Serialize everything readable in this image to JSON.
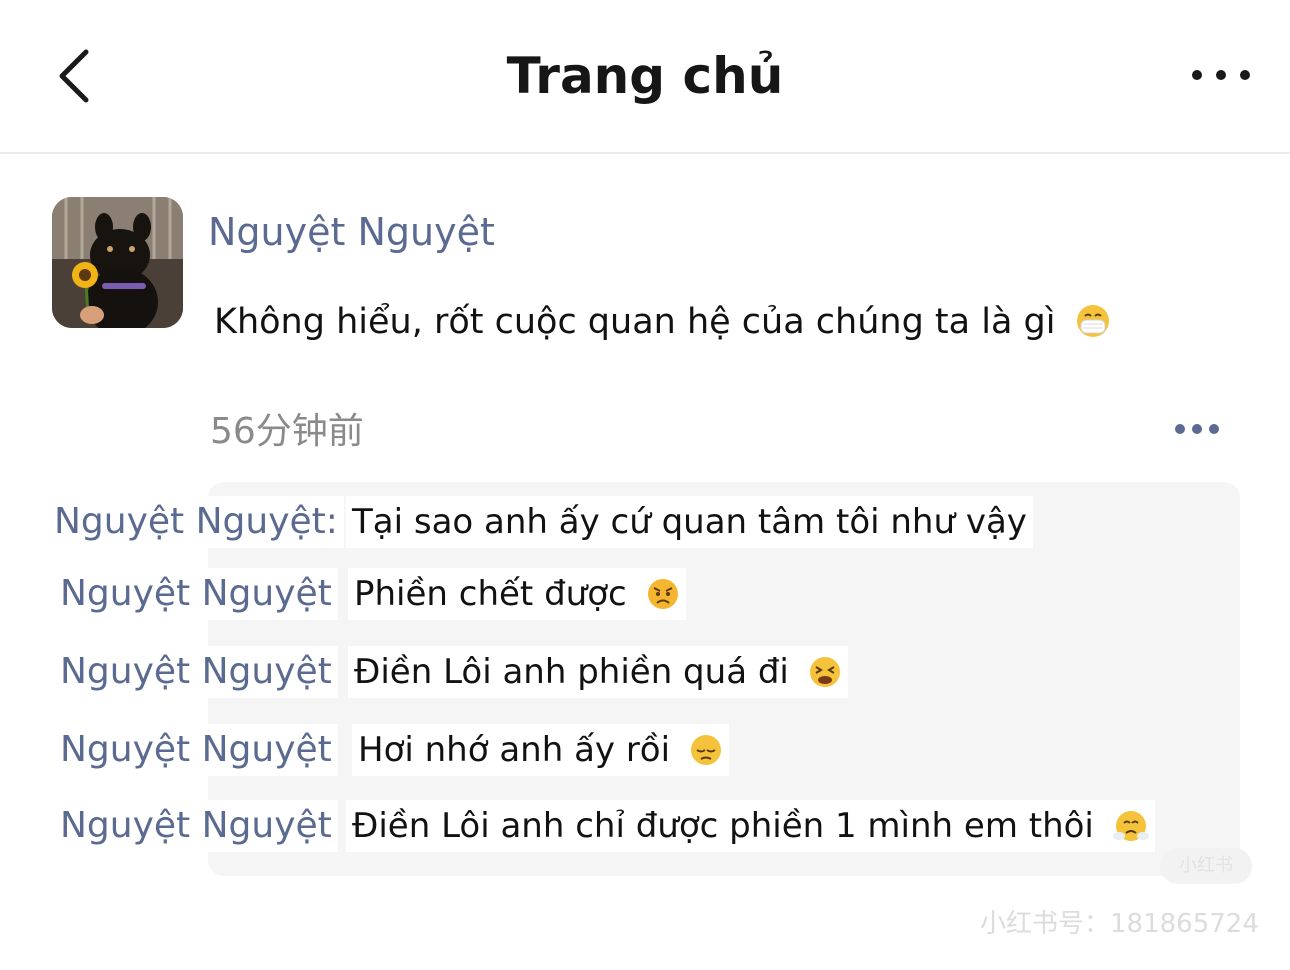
{
  "header": {
    "title": "Trang chủ",
    "back_icon": "chevron-left-icon",
    "more_icon": "more-horizontal-icon"
  },
  "post": {
    "author": "Nguyệt Nguyệt",
    "avatar_icon": "dog-with-sunflower-avatar",
    "text": "Không hiểu, rốt cuộc quan hệ của chúng ta là gì",
    "text_emoji": "face-with-medical-mask-emoji",
    "timestamp": "56分钟前",
    "more_icon": "more-horizontal-icon"
  },
  "comments": [
    {
      "name": "Nguyệt Nguyệt:",
      "text": "Tại sao anh ấy cứ quan tâm tôi như vậy",
      "emoji": ""
    },
    {
      "name": "Nguyệt Nguyệt",
      "text": "Phiền chết được",
      "emoji": "angry-face-emoji"
    },
    {
      "name": "Nguyệt Nguyệt",
      "text": "Điền Lôi anh phiền quá đi",
      "emoji": "tired-face-emoji"
    },
    {
      "name": "Nguyệt Nguyệt",
      "text": "Hơi nhớ anh ấy rồi",
      "emoji": "pensive-face-emoji"
    },
    {
      "name": "Nguyệt Nguyệt",
      "text": "Điền Lôi anh chỉ được phiền 1 mình em thôi",
      "emoji": "face-with-steam-emoji"
    }
  ],
  "watermark": {
    "badge": "小红书",
    "id_label": "小红书号：181865724"
  },
  "colors": {
    "name": "#5a6a91",
    "text": "#121212",
    "timestamp": "#8a8a8a",
    "panel": "#f5f5f5",
    "emoji": "#f5c33b"
  }
}
